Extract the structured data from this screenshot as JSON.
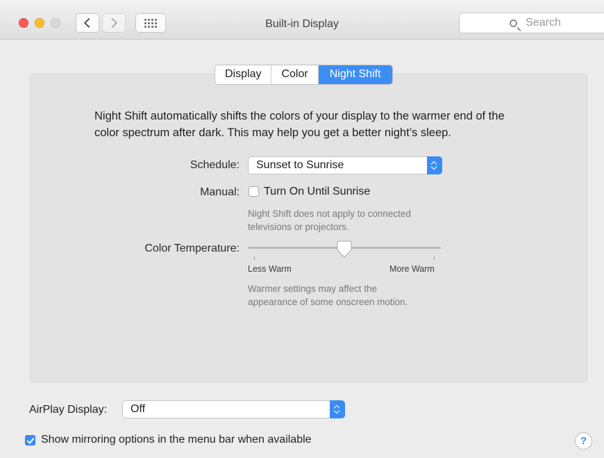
{
  "window": {
    "title": "Built-in Display",
    "search_placeholder": "Search"
  },
  "tabs": [
    {
      "label": "Display",
      "active": false
    },
    {
      "label": "Color",
      "active": false
    },
    {
      "label": "Night Shift",
      "active": true
    }
  ],
  "night_shift": {
    "description_line1": "Night Shift automatically shifts the colors of your display to the warmer end of the",
    "description_line2": "color spectrum after dark. This may help you get a better night’s sleep.",
    "schedule_label": "Schedule:",
    "schedule_value": "Sunset to Sunrise",
    "manual_label": "Manual:",
    "manual_checkbox_label": "Turn On Until Sunrise",
    "manual_checked": false,
    "manual_note_line1": "Night Shift does not apply to connected",
    "manual_note_line2": "televisions or projectors.",
    "temperature_label": "Color Temperature:",
    "temperature_level": 0.5,
    "less_warm": "Less Warm",
    "more_warm": "More Warm",
    "temperature_note_line1": "Warmer settings may affect the",
    "temperature_note_line2": "appearance of some onscreen motion."
  },
  "airplay": {
    "label": "AirPlay Display:",
    "value": "Off"
  },
  "mirroring": {
    "label": "Show mirroring options in the menu bar when available",
    "checked": true
  },
  "help_label": "?",
  "colors": {
    "accent": "#3a8cf3",
    "close": "#fc5b57",
    "minimize": "#fdbc2e",
    "zoom_disabled": "#d8d8d8"
  },
  "icons": [
    "back-chevron-icon",
    "forward-chevron-icon",
    "grid-icon",
    "search-icon",
    "checkmark-icon",
    "stepper-arrows-icon",
    "help-icon"
  ]
}
